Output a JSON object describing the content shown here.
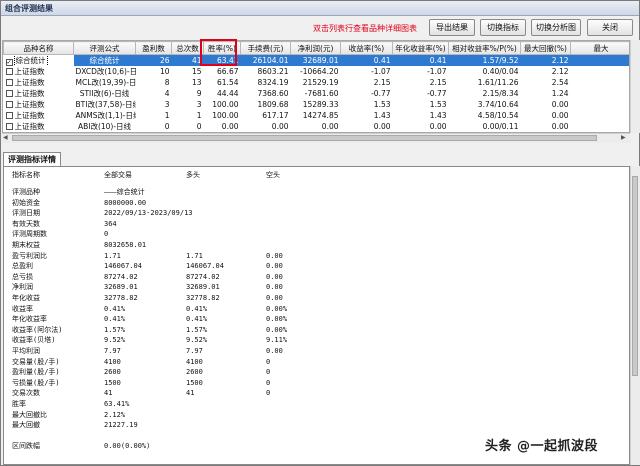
{
  "window": {
    "title": "组合评测结果"
  },
  "toolbar": {
    "hint": "双击列表行查看品种详细图表",
    "buttons": [
      "导出结果",
      "切换指标",
      "切换分析图",
      "关闭"
    ]
  },
  "table": {
    "columns": [
      "品种名称",
      "评测公式",
      "盈利数",
      "总次数",
      "胜率(%)",
      "手续费(元)",
      "净利润(元)",
      "收益率(%)",
      "年化收益率(%)",
      "相对收益率%/P(%)",
      "最大回撤(%)",
      "最大"
    ],
    "rows": [
      {
        "name": "综合统计",
        "formula": "综合统计",
        "wins": "26",
        "total": "41",
        "winrate": "63.41",
        "fee": "26104.01",
        "profit": "32689.01",
        "ret": "0.41",
        "annual": "0.41",
        "rel": "1.57/9.52",
        "dd": "2.12",
        "checked": true,
        "selected": true
      },
      {
        "name": "上证指数",
        "formula": "DXCD改(10,6)-日线",
        "wins": "10",
        "total": "15",
        "winrate": "66.67",
        "fee": "8603.21",
        "profit": "-10664.20",
        "ret": "-1.07",
        "annual": "-1.07",
        "rel": "0.40/0.04",
        "dd": "2.12",
        "checked": false,
        "selected": false
      },
      {
        "name": "上证指数",
        "formula": "MCL改(19,39)-日线",
        "wins": "8",
        "total": "13",
        "winrate": "61.54",
        "fee": "8324.19",
        "profit": "21529.19",
        "ret": "2.15",
        "annual": "2.15",
        "rel": "1.61/11.26",
        "dd": "2.54",
        "checked": false,
        "selected": false
      },
      {
        "name": "上证指数",
        "formula": "STII改(6)-日线",
        "wins": "4",
        "total": "9",
        "winrate": "44.44",
        "fee": "7368.60",
        "profit": "-7681.60",
        "ret": "-0.77",
        "annual": "-0.77",
        "rel": "2.15/8.34",
        "dd": "1.24",
        "checked": false,
        "selected": false
      },
      {
        "name": "上证指数",
        "formula": "BTI改(37,58)-日线",
        "wins": "3",
        "total": "3",
        "winrate": "100.00",
        "fee": "1809.68",
        "profit": "15289.33",
        "ret": "1.53",
        "annual": "1.53",
        "rel": "3.74/10.64",
        "dd": "0.00",
        "checked": false,
        "selected": false
      },
      {
        "name": "上证指数",
        "formula": "ANMS改(1,1)-日线",
        "wins": "1",
        "total": "1",
        "winrate": "100.00",
        "fee": "617.17",
        "profit": "14274.85",
        "ret": "1.43",
        "annual": "1.43",
        "rel": "4.58/10.54",
        "dd": "0.00",
        "checked": false,
        "selected": false
      },
      {
        "name": "上证指数",
        "formula": "ABI改(10)-日线",
        "wins": "0",
        "total": "0",
        "winrate": "0.00",
        "fee": "0.00",
        "profit": "0.00",
        "ret": "0.00",
        "annual": "0.00",
        "rel": "0.00/0.11",
        "dd": "0.00",
        "checked": false,
        "selected": false
      }
    ]
  },
  "detail": {
    "tab": "评测指标详情",
    "header": [
      "指标名称",
      "全部交易",
      "多头",
      "空头"
    ],
    "rows": [
      [
        "评测品种",
        "———综合统计",
        "",
        ""
      ],
      [
        "初始资金",
        "8000000.00",
        "",
        ""
      ],
      [
        "评测日期",
        "2022/09/13-2023/09/13",
        "",
        ""
      ],
      [
        "有效天数",
        "364",
        "",
        ""
      ],
      [
        "评测周期数",
        "0",
        "",
        ""
      ],
      [
        "期末权益",
        "8032658.01",
        "",
        ""
      ],
      [
        "盈亏利润比",
        "1.71",
        "1.71",
        "0.00"
      ],
      [
        "总盈利",
        "146067.04",
        "146067.04",
        "0.00"
      ],
      [
        "总亏损",
        "87274.02",
        "87274.02",
        "0.00"
      ],
      [
        "净利润",
        "32689.01",
        "32689.01",
        "0.00"
      ],
      [
        "年化收益",
        "32778.82",
        "32778.82",
        "0.00"
      ],
      [
        "收益率",
        "0.41%",
        "0.41%",
        "0.00%"
      ],
      [
        "年化收益率",
        "0.41%",
        "0.41%",
        "0.00%"
      ],
      [
        "收益率(阿尔法)",
        "1.57%",
        "1.57%",
        "0.00%"
      ],
      [
        "收益率(贝塔)",
        "9.52%",
        "9.52%",
        "9.11%"
      ],
      [
        "平均利润",
        "7.97",
        "7.97",
        "0.00"
      ],
      [
        "交易量(股/手)",
        "4100",
        "4100",
        "0"
      ],
      [
        "盈利量(股/手)",
        "2600",
        "2600",
        "0"
      ],
      [
        "亏损量(股/手)",
        "1500",
        "1500",
        "0"
      ],
      [
        "交易次数",
        "41",
        "41",
        "0"
      ],
      [
        "胜率",
        "63.41%",
        "",
        ""
      ],
      [
        "最大回撤比",
        "2.12%",
        "",
        ""
      ],
      [
        "最大回撤",
        "21227.19",
        "",
        ""
      ],
      [
        "",
        "",
        "",
        ""
      ],
      [
        "区间跌幅",
        "0.00(0.00%)",
        "",
        ""
      ]
    ]
  },
  "watermark": "头条 @一起抓波段"
}
